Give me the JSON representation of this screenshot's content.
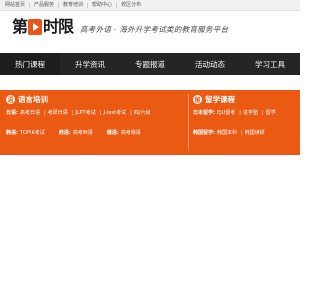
{
  "topbar": {
    "links": [
      "网站首页",
      "产品服务",
      "教育培训",
      "帮助中心",
      "校区分布"
    ]
  },
  "header": {
    "logo_chars": [
      "第",
      "时",
      "限"
    ],
    "slogan": "高考外语 · 海外升学考试类的教育服务平台"
  },
  "mainnav": {
    "items": [
      "热门课程",
      "升学资讯",
      "专题报道",
      "活动动态",
      "学习工具"
    ]
  },
  "language_section": {
    "icon": "语",
    "title": "语言培训",
    "row1": {
      "label": "日语:",
      "items": [
        "高考日语",
        "考研日语",
        "JLPT考试",
        "J-test考试",
        "四/六级"
      ]
    },
    "row2": {
      "groups": [
        {
          "label": "韩语:",
          "value": "TOPIK考试"
        },
        {
          "label": "西语:",
          "value": "高考西语"
        },
        {
          "label": "俄语:",
          "value": "高考俄语"
        }
      ]
    }
  },
  "study_section": {
    "icon": "留",
    "title": "留学课程",
    "row1": {
      "label": "日本留学:",
      "items": [
        "EJU留考",
        "进学塾",
        "留学"
      ]
    },
    "row2": {
      "label": "韩国留学:",
      "items": [
        "韩国本科",
        "韩国读研"
      ]
    }
  }
}
